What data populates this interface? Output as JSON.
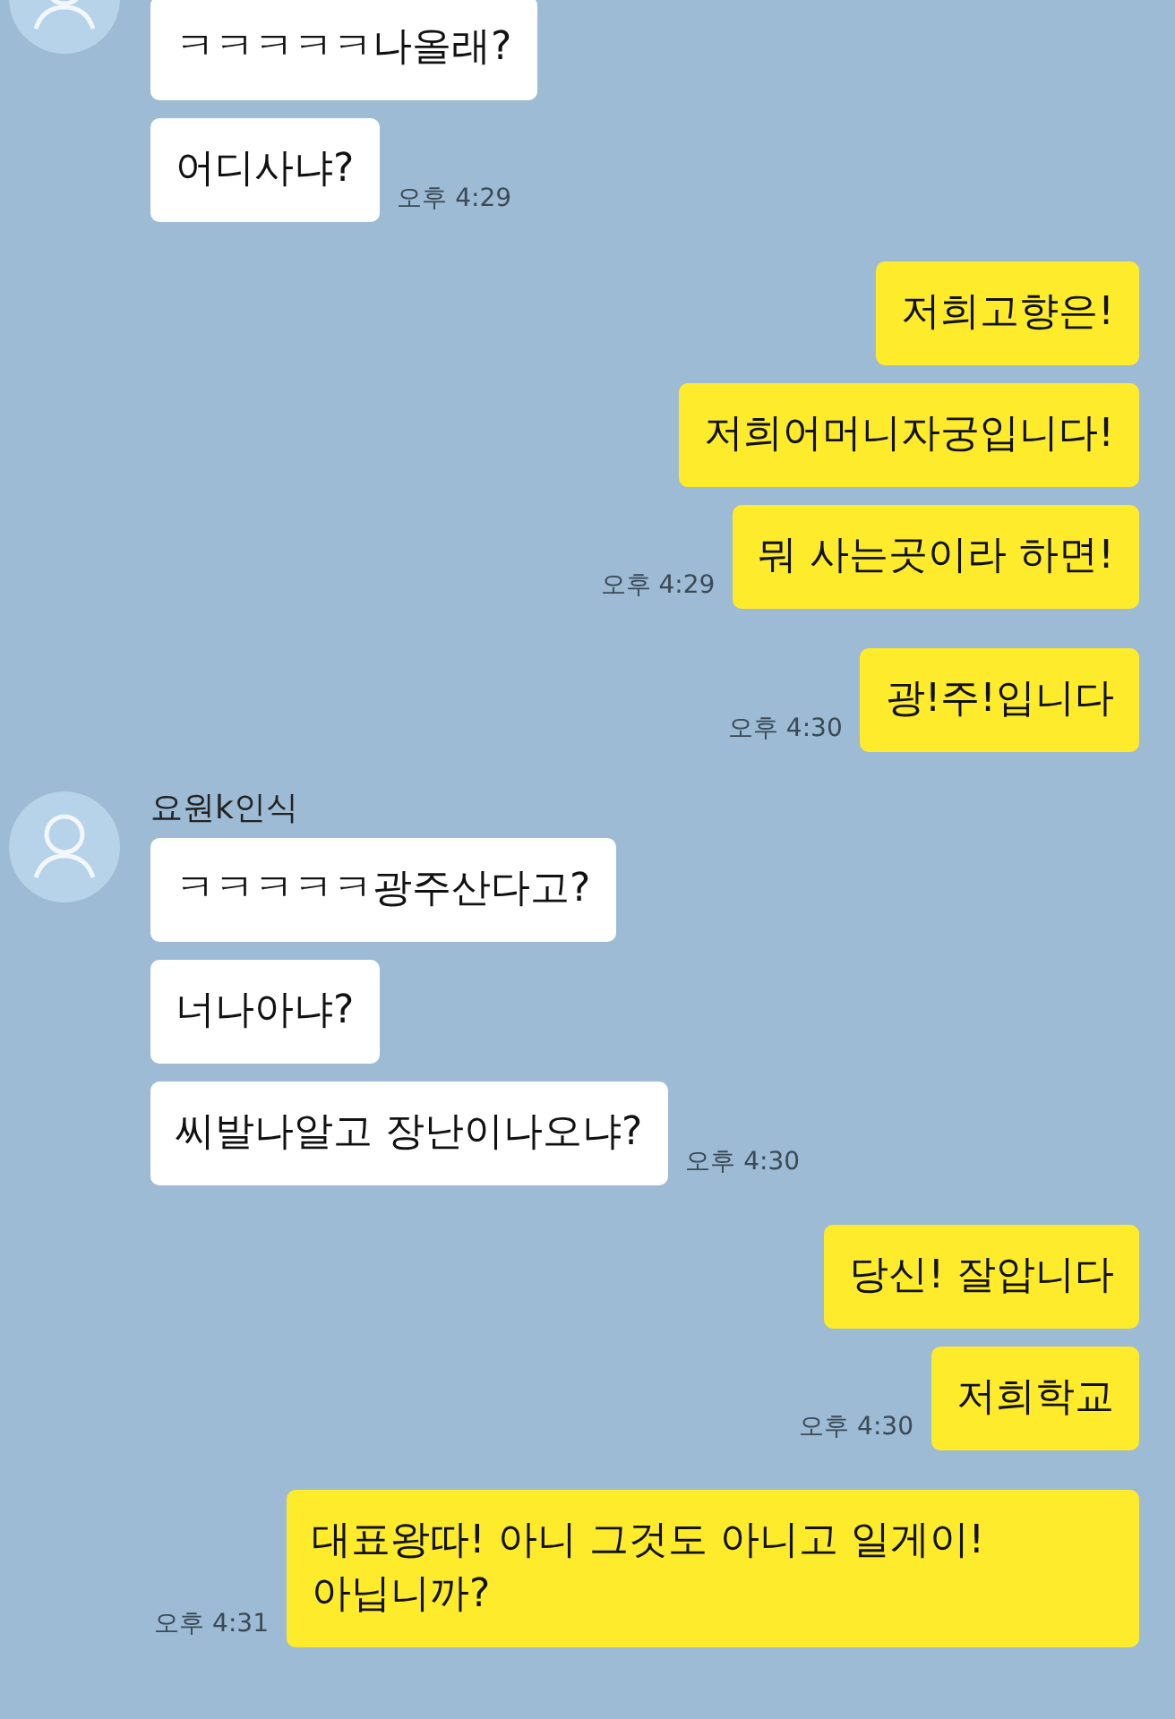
{
  "messages": [
    {
      "kind": "received",
      "bubbles": [
        {
          "text": "ㅋㅋㅋㅋㅋ나올래?"
        },
        {
          "text": "어디사냐?",
          "time": "오후 4:29"
        }
      ]
    },
    {
      "kind": "sent",
      "bubbles": [
        {
          "text": "저희고향은!"
        },
        {
          "text": "저희어머니자궁입니다!"
        },
        {
          "text": "뭐 사는곳이라 하면!",
          "time": "오후 4:29"
        }
      ]
    },
    {
      "kind": "sent",
      "bubbles": [
        {
          "text": "광!주!입니다",
          "time": "오후 4:30"
        }
      ]
    },
    {
      "kind": "received",
      "sender": "요원k인식",
      "bubbles": [
        {
          "text": "ㅋㅋㅋㅋㅋ광주산다고?"
        },
        {
          "text": "너나아냐?"
        },
        {
          "text": "씨발나알고 장난이나오냐?",
          "time": "오후 4:30"
        }
      ]
    },
    {
      "kind": "sent",
      "bubbles": [
        {
          "text": "당신! 잘압니다"
        },
        {
          "text": "저희학교",
          "time": "오후 4:30"
        }
      ]
    },
    {
      "kind": "sent",
      "bubbles": [
        {
          "text": "대표왕따! 아니 그것도 아니고 일게이! 아닙니까?",
          "time": "오후 4:31"
        }
      ]
    }
  ]
}
